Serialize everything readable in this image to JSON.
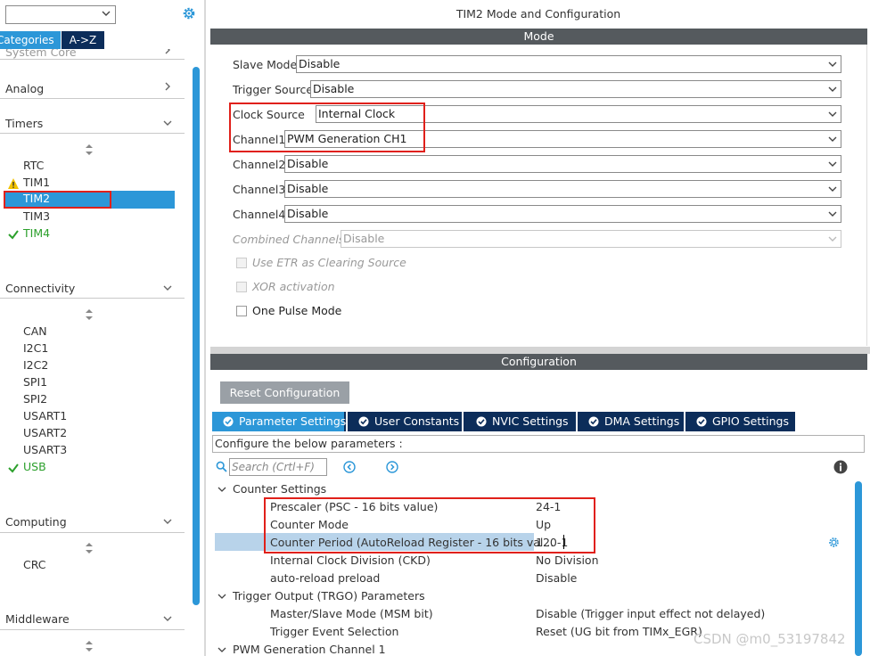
{
  "left": {
    "search_value": "",
    "tabs": {
      "categories": "Categories",
      "az": "A->Z"
    },
    "categories": [
      {
        "label": "System Core"
      },
      {
        "label": "Analog"
      },
      {
        "label": "Timers"
      },
      {
        "label": "Connectivity"
      },
      {
        "label": "Computing"
      },
      {
        "label": "Middleware"
      }
    ],
    "timers": [
      {
        "label": "RTC",
        "status": "none"
      },
      {
        "label": "TIM1",
        "status": "warning"
      },
      {
        "label": "TIM2",
        "status": "selected"
      },
      {
        "label": "TIM3",
        "status": "none"
      },
      {
        "label": "TIM4",
        "status": "ok"
      }
    ],
    "connectivity": [
      {
        "label": "CAN",
        "status": "none"
      },
      {
        "label": "I2C1",
        "status": "none"
      },
      {
        "label": "I2C2",
        "status": "none"
      },
      {
        "label": "SPI1",
        "status": "none"
      },
      {
        "label": "SPI2",
        "status": "none"
      },
      {
        "label": "USART1",
        "status": "none"
      },
      {
        "label": "USART2",
        "status": "none"
      },
      {
        "label": "USART3",
        "status": "none"
      },
      {
        "label": "USB",
        "status": "ok"
      }
    ],
    "computing": [
      {
        "label": "CRC",
        "status": "none"
      }
    ]
  },
  "right": {
    "title": "TIM2 Mode and Configuration",
    "mode_header": "Mode",
    "mode_rows": [
      {
        "label": "Slave Mode",
        "value": "Disable",
        "enabled": true
      },
      {
        "label": "Trigger Source",
        "value": "Disable",
        "enabled": true
      },
      {
        "label": "Clock Source",
        "value": "Internal Clock",
        "enabled": true
      },
      {
        "label": "Channel1",
        "value": "PWM Generation CH1",
        "enabled": true
      },
      {
        "label": "Channel2",
        "value": "Disable",
        "enabled": true
      },
      {
        "label": "Channel3",
        "value": "Disable",
        "enabled": true
      },
      {
        "label": "Channel4",
        "value": "Disable",
        "enabled": true
      },
      {
        "label": "Combined Channels",
        "value": "Disable",
        "enabled": false
      }
    ],
    "checkboxes": [
      {
        "label": "Use ETR as Clearing Source",
        "checked": false,
        "enabled": false
      },
      {
        "label": "XOR activation",
        "checked": false,
        "enabled": false
      },
      {
        "label": "One Pulse Mode",
        "checked": false,
        "enabled": true
      }
    ],
    "config_header": "Configuration",
    "reset_button": "Reset Configuration",
    "config_tabs": [
      {
        "label": "Parameter Settings",
        "active": true
      },
      {
        "label": "User Constants",
        "active": false
      },
      {
        "label": "NVIC Settings",
        "active": false
      },
      {
        "label": "DMA Settings",
        "active": false
      },
      {
        "label": "GPIO Settings",
        "active": false
      }
    ],
    "hint": "Configure the below parameters :",
    "search_placeholder": "Search (Crtl+F)",
    "groups": [
      {
        "label": "Counter Settings",
        "params": [
          {
            "name": "Prescaler (PSC - 16 bits value)",
            "value": "24-1"
          },
          {
            "name": "Counter Mode",
            "value": "Up"
          },
          {
            "name": "Counter Period (AutoReload Register - 16 bits val...",
            "value": "120-1"
          },
          {
            "name": "Internal Clock Division (CKD)",
            "value": "No Division"
          },
          {
            "name": "auto-reload preload",
            "value": "Disable"
          }
        ]
      },
      {
        "label": "Trigger Output (TRGO) Parameters",
        "params": [
          {
            "name": "Master/Slave Mode (MSM bit)",
            "value": "Disable (Trigger input effect not delayed)"
          },
          {
            "name": "Trigger Event Selection",
            "value": "Reset (UG bit from TIMx_EGR)"
          }
        ]
      },
      {
        "label": "PWM Generation Channel 1",
        "params": []
      }
    ],
    "watermark": "CSDN @m0_53197842"
  },
  "colors": {
    "accent_blue": "#2c97d8",
    "dark_navy": "#0c2d5a",
    "header_gray": "#555a5e",
    "highlight_red": "#e0201a",
    "ok_green": "#2ca02c",
    "warning_yellow": "#f2c200"
  },
  "icons": {
    "left_search_dropdown": "chevron-down-icon",
    "left_settings": "gear-icon",
    "category_collapsed": "chevron-right-icon",
    "category_expanded": "chevron-down-icon",
    "sort": "sort-arrows-icon",
    "status_warning": "warning-icon",
    "status_ok": "checkmark-icon",
    "tab_status": "check-circle-icon",
    "nav_prev": "circle-left-icon",
    "nav_next": "circle-right-icon",
    "info": "info-icon",
    "param_settings": "gear-icon"
  }
}
